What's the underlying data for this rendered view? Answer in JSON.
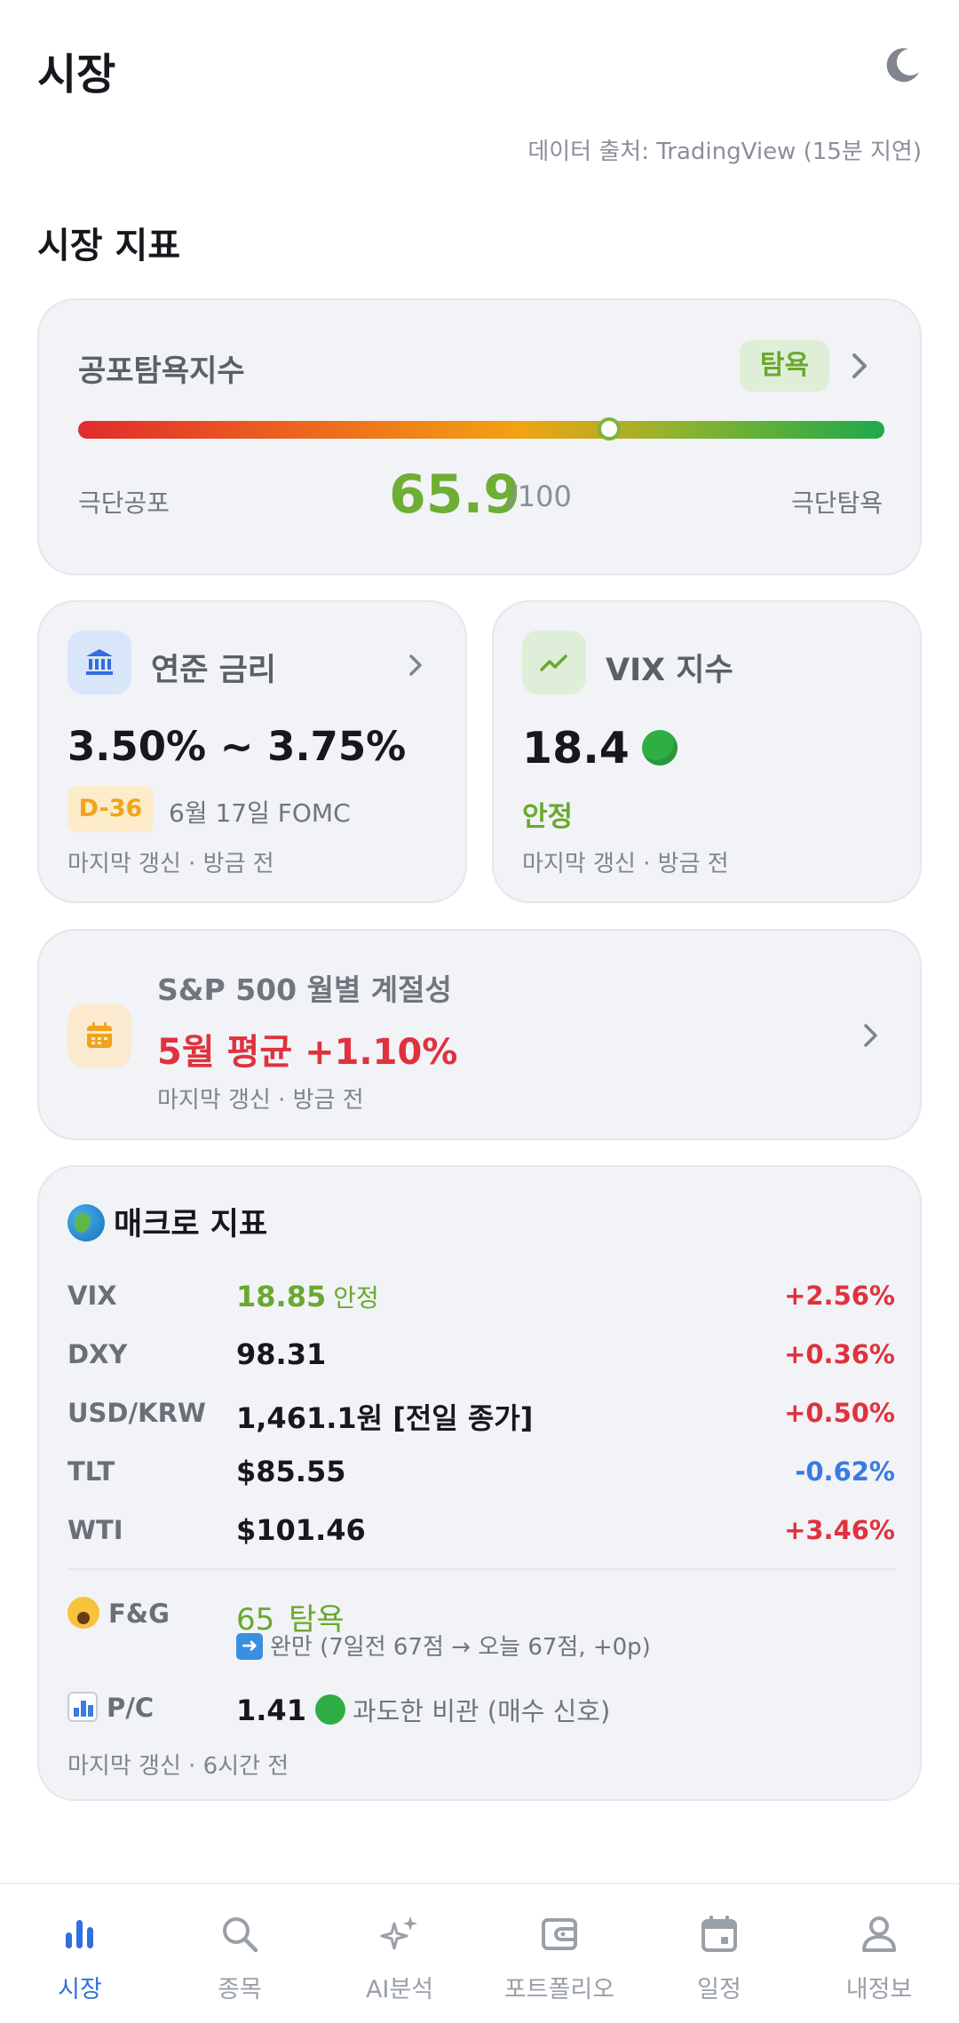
{
  "header": {
    "title": "시장",
    "theme_icon": "moon-icon",
    "source_note": "데이터 출처: TradingView (15분 지연)"
  },
  "section_title": "시장 지표",
  "fear_greed": {
    "title": "공포탐욕지수",
    "badge": "탐욕",
    "value": "65.9",
    "denominator": "/100",
    "min_label": "극단공포",
    "max_label": "극단탐욕",
    "level": 0.659
  },
  "fed_rate": {
    "title": "연준 금리",
    "icon": "bank-icon",
    "value": "3.50% ~ 3.75%",
    "dday": "D-36",
    "event": "6월 17일 FOMC",
    "updated": "마지막 갱신 · 방금 전"
  },
  "vix_card": {
    "title": "VIX 지수",
    "icon": "trending-up-icon",
    "value": "18.4",
    "status": "안정",
    "updated": "마지막 갱신 · 방금 전"
  },
  "seasonality": {
    "title": "S&P 500 월별 계절성",
    "icon": "calendar-icon",
    "value": "5월 평균 +1.10%",
    "updated": "마지막 갱신 · 방금 전"
  },
  "macro": {
    "title": "매크로 지표",
    "rows": [
      {
        "label": "VIX",
        "value": "18.85",
        "note": "안정",
        "change": "+2.56%"
      },
      {
        "label": "DXY",
        "value": "98.31",
        "note": "",
        "change": "+0.36%"
      },
      {
        "label": "USD/KRW",
        "value": "1,461.1원 [전일 종가]",
        "note": "",
        "change": "+0.50%"
      },
      {
        "label": "TLT",
        "value": "$85.55",
        "note": "",
        "change": "-0.62%"
      },
      {
        "label": "WTI",
        "value": "$101.46",
        "note": "",
        "change": "+3.46%"
      }
    ],
    "fg_label": "F&G",
    "fg_value": "65",
    "fg_status": "탐욕",
    "fg_sub": "완만 (7일전 67점 → 오늘 67점, +0p)",
    "pc_label": "P/C",
    "pc_value": "1.41",
    "pc_note": "과도한 비관 (매수 신호)",
    "updated": "마지막 갱신 · 6시간 전"
  },
  "nav": {
    "items": [
      {
        "label": "시장",
        "icon": "bar-chart-icon",
        "active": true
      },
      {
        "label": "종목",
        "icon": "search-icon",
        "active": false
      },
      {
        "label": "AI분석",
        "icon": "sparkle-icon",
        "active": false
      },
      {
        "label": "포트폴리오",
        "icon": "wallet-icon",
        "active": false
      },
      {
        "label": "일정",
        "icon": "calendar-icon",
        "active": false
      },
      {
        "label": "내정보",
        "icon": "user-icon",
        "active": false
      }
    ]
  },
  "colors": {
    "accent_blue": "#2f6fde",
    "greed_green": "#6aa82f",
    "up_red": "#e0323e",
    "down_blue": "#3a7be0",
    "dday_orange": "#f0a419"
  }
}
